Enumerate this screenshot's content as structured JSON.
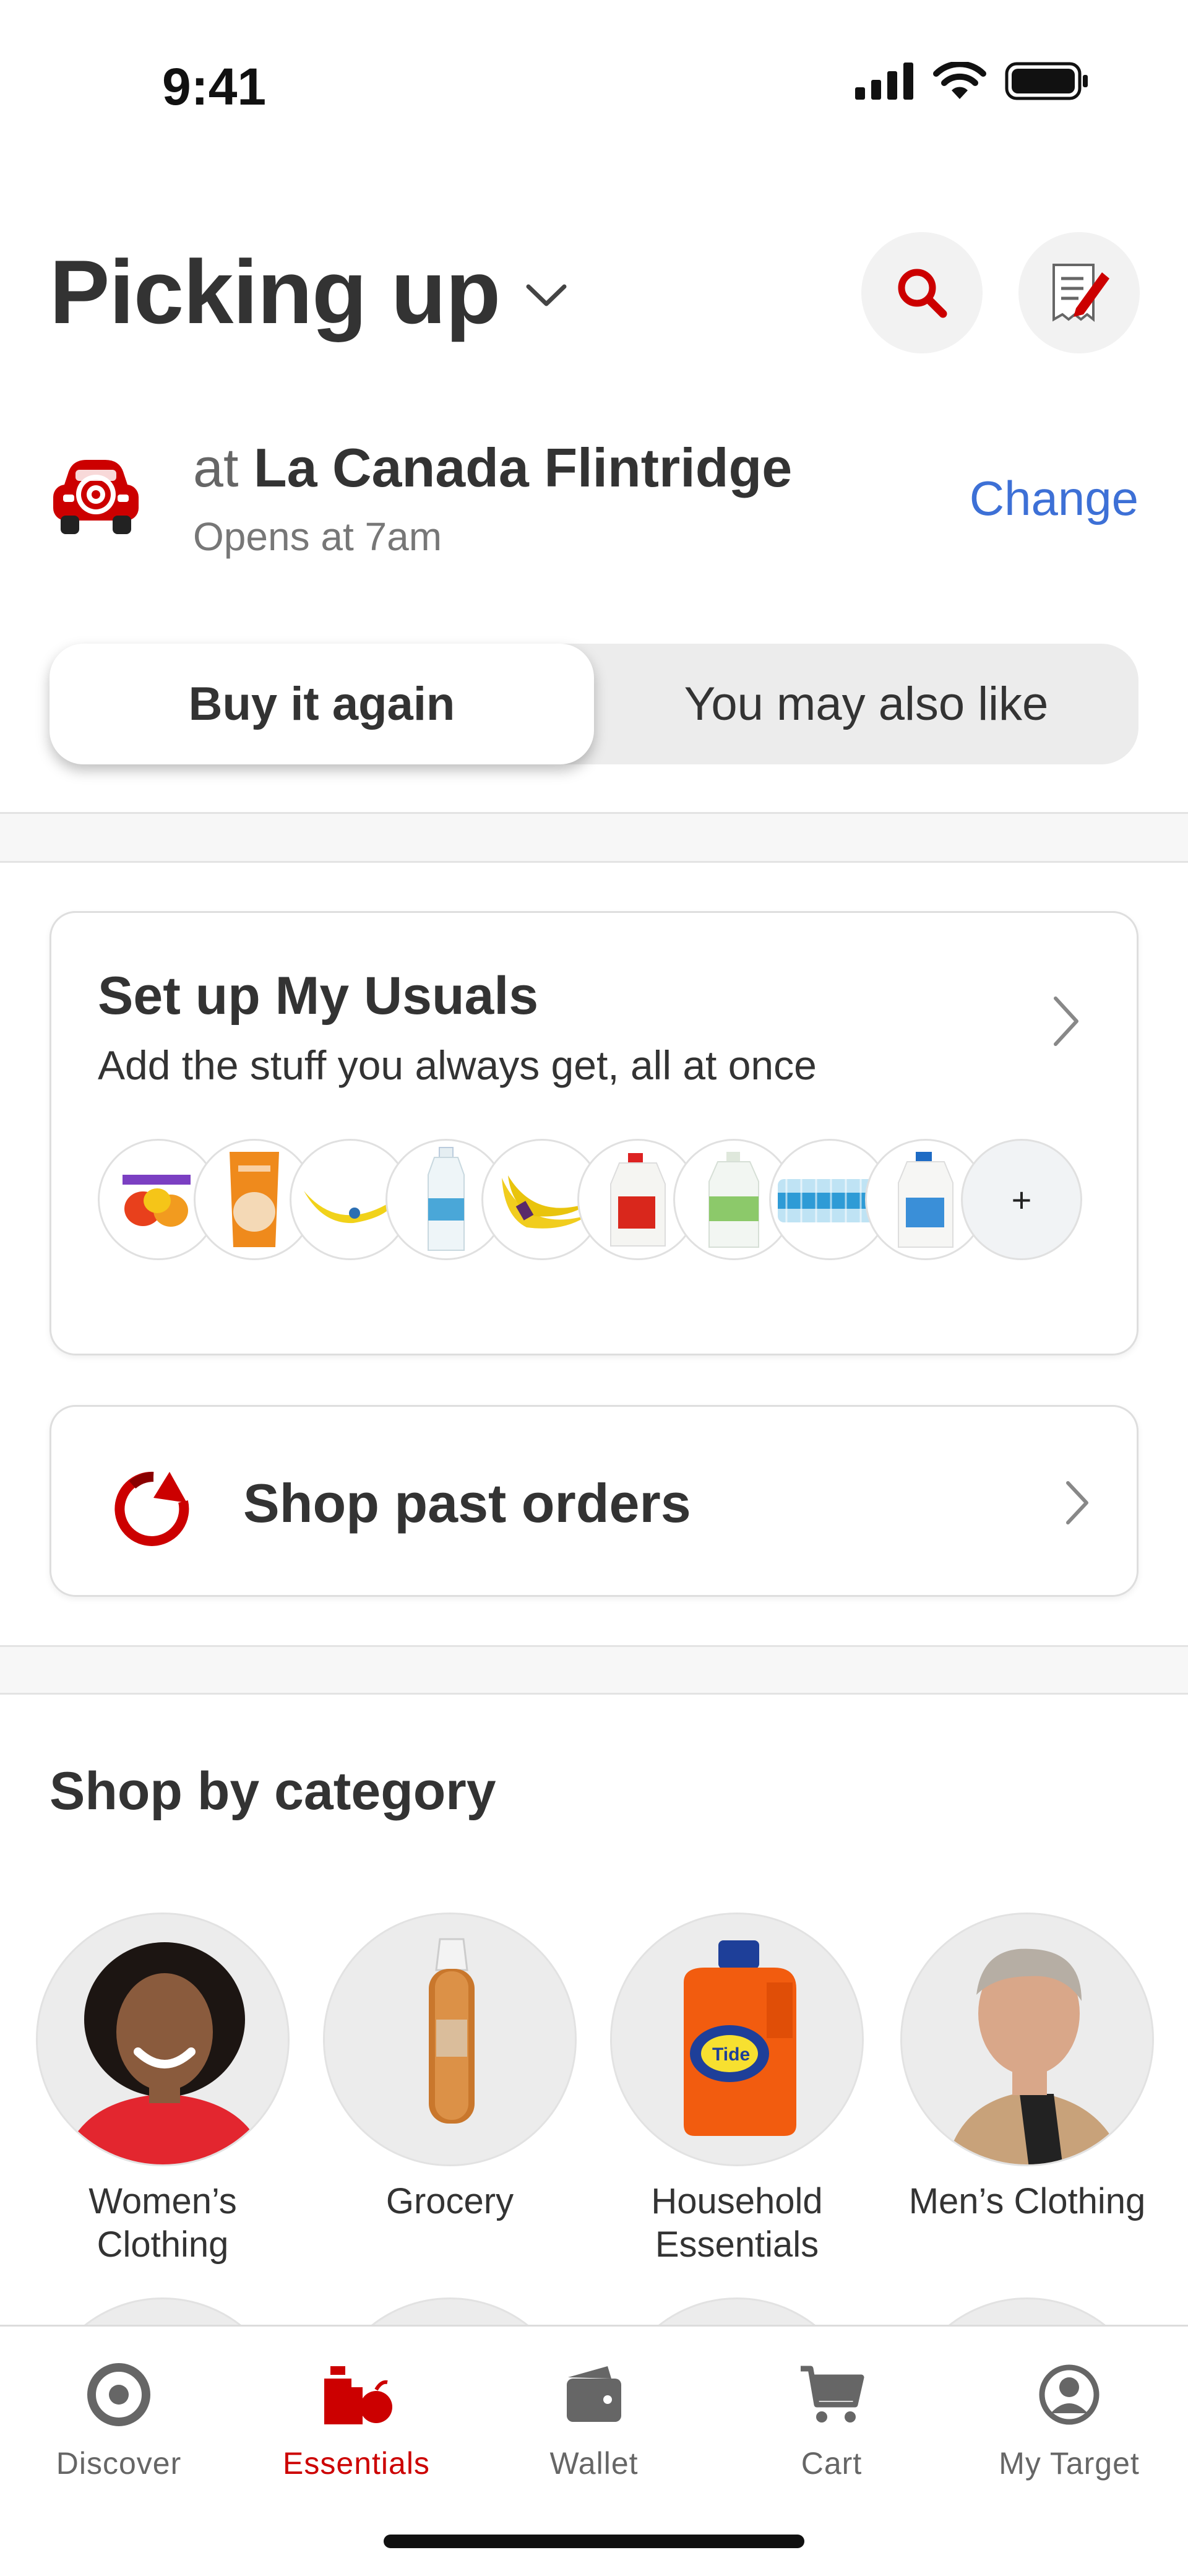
{
  "status_bar": {
    "time": "9:41"
  },
  "header": {
    "title": "Picking up"
  },
  "store": {
    "prefix": "at",
    "name": "La Canada Flintridge",
    "hours": "Opens at 7am",
    "change_label": "Change"
  },
  "segments": {
    "active": "Buy it again",
    "inactive": "You may also like"
  },
  "usuals": {
    "title": "Set up My Usuals",
    "subtitle": "Add the stuff you always get, all at once",
    "items": [
      "peppers-icon",
      "shredded-chicken-icon",
      "banana-icon",
      "water-bottle-icon",
      "bananas-bunch-icon",
      "milk-gallon-icon",
      "water-jug-icon",
      "water-case-icon",
      "milk-jug-icon"
    ],
    "more_label": "+"
  },
  "past_orders": {
    "label": "Shop past orders"
  },
  "categories": {
    "title": "Shop by category",
    "items": [
      {
        "label": "Women’s Clothing"
      },
      {
        "label": "Grocery"
      },
      {
        "label": "Household Essentials"
      },
      {
        "label": "Men’s Clothing"
      }
    ]
  },
  "tabs": [
    {
      "label": "Discover",
      "icon": "target-icon",
      "active": false
    },
    {
      "label": "Essentials",
      "icon": "essentials-icon",
      "active": true
    },
    {
      "label": "Wallet",
      "icon": "wallet-icon",
      "active": false
    },
    {
      "label": "Cart",
      "icon": "cart-icon",
      "active": false
    },
    {
      "label": "My Target",
      "icon": "profile-icon",
      "active": false
    }
  ],
  "colors": {
    "brand_red": "#cc0000",
    "link_blue": "#3d70d6",
    "text": "#333333"
  }
}
